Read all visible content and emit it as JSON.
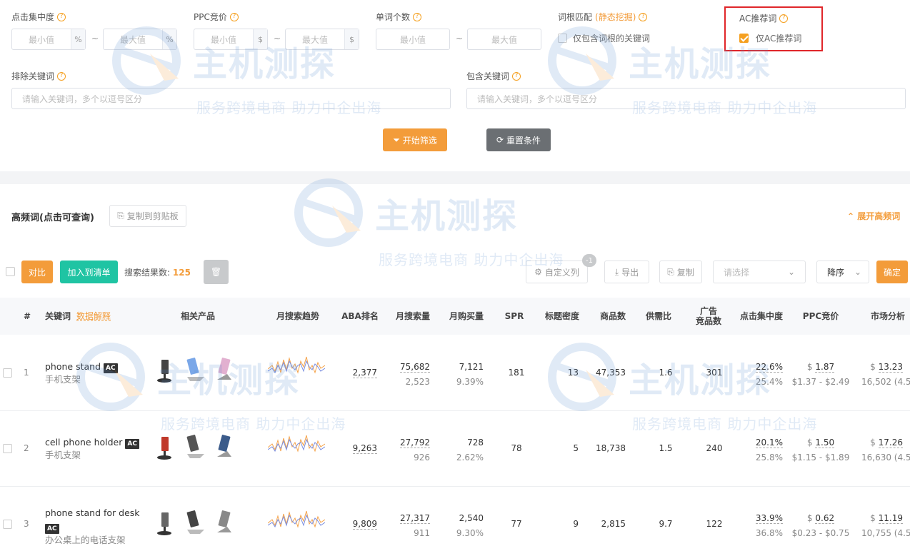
{
  "filters": {
    "click_concentration": {
      "label": "点击集中度",
      "min_ph": "最小值",
      "max_ph": "最大值",
      "unit": "%"
    },
    "ppc_bid": {
      "label": "PPC竞价",
      "min_ph": "最小值",
      "max_ph": "最大值",
      "unit": "$"
    },
    "word_count": {
      "label": "单词个数",
      "min_ph": "最小值",
      "max_ph": "最大值"
    },
    "root_match": {
      "label": "词根匹配",
      "label_highlight": "(静态挖掘)",
      "option": "仅包含词根的关键词"
    },
    "ac_recommend": {
      "label": "AC推荐词",
      "option": "仅AC推荐词"
    },
    "exclude_keywords": {
      "label": "排除关键词",
      "placeholder": "请输入关键词，多个以逗号区分"
    },
    "include_keywords": {
      "label": "包含关键词",
      "placeholder": "请输入关键词，多个以逗号区分"
    },
    "tilde": "~",
    "start_button": "开始筛选",
    "reset_button": "重置条件"
  },
  "high_freq": {
    "title": "高频词(点击可查询)",
    "copy_button": "复制到剪贴板",
    "expand": "展开高频词"
  },
  "toolbar": {
    "compare": "对比",
    "add_to_list": "加入到清单",
    "result_label": "搜索结果数:",
    "result_count": "125",
    "custom_columns": "自定义列",
    "custom_badge": "-1",
    "export": "导出",
    "copy": "复制",
    "select_ph": "请选择",
    "sort": "降序",
    "confirm": "确定"
  },
  "table": {
    "headers": {
      "index": "#",
      "keyword": "关键词",
      "keyword_link": "数据解释",
      "products": "相关产品",
      "trend": "月搜索趋势",
      "aba": "ABA排名",
      "monthly_search": "月搜索量",
      "monthly_purchase": "月购买量",
      "spr": "SPR",
      "title_density": "标题密度",
      "product_count": "商品数",
      "supply_demand": "供需比",
      "ad_competitors_1": "广告",
      "ad_competitors_2": "竞品数",
      "click_conc": "点击集中度",
      "ppc": "PPC竞价",
      "market": "市场分析"
    },
    "rows": [
      {
        "idx": "1",
        "keyword": "phone stand",
        "ac": "AC",
        "cn": "手机支架",
        "aba": "2,377",
        "search": "75,682",
        "search_sub": "2,523",
        "purchase": "7,121",
        "purchase_sub": "9.39%",
        "spr": "181",
        "density": "13",
        "products": "47,353",
        "ratio": "1.6",
        "ads": "301",
        "conc": "22.6%",
        "conc_sub": "25.4%",
        "ppc_sym": "$",
        "ppc": "1.87",
        "ppc_range": "$1.37 - $2.49",
        "mkt_sym": "$",
        "mkt": "13.23",
        "mkt_sub": "16,502 (4.5"
      },
      {
        "idx": "2",
        "keyword": "cell phone holder",
        "ac": "AC",
        "cn": "手机支架",
        "aba": "9,263",
        "search": "27,792",
        "search_sub": "926",
        "purchase": "728",
        "purchase_sub": "2.62%",
        "spr": "78",
        "density": "5",
        "products": "18,738",
        "ratio": "1.5",
        "ads": "240",
        "conc": "20.1%",
        "conc_sub": "25.8%",
        "ppc_sym": "$",
        "ppc": "1.50",
        "ppc_range": "$1.15 - $1.89",
        "mkt_sym": "$",
        "mkt": "17.26",
        "mkt_sub": "16,630 (4.5"
      },
      {
        "idx": "3",
        "keyword": "phone stand for desk",
        "ac": "AC",
        "cn": "办公桌上的电话支架",
        "aba": "9,809",
        "search": "27,317",
        "search_sub": "911",
        "purchase": "2,540",
        "purchase_sub": "9.30%",
        "spr": "77",
        "density": "9",
        "products": "2,815",
        "ratio": "9.7",
        "ads": "122",
        "conc": "33.9%",
        "conc_sub": "36.8%",
        "ppc_sym": "$",
        "ppc": "0.62",
        "ppc_range": "$0.23 - $0.75",
        "mkt_sym": "$",
        "mkt": "11.19",
        "mkt_sub": "10,755 (4.5"
      }
    ]
  },
  "watermark": {
    "brand": "主机测探",
    "slogan": "服务跨境电商 助力中企出海"
  },
  "colors": {
    "accent": "#f39c3a",
    "teal": "#1fc4a3",
    "highlight_box": "#e0262a"
  }
}
